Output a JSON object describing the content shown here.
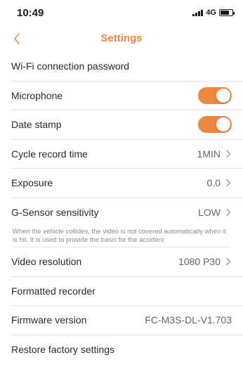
{
  "status_bar": {
    "time": "10:49",
    "network": "4G"
  },
  "nav": {
    "title": "Settings",
    "back_icon": "chevron-left-icon"
  },
  "colors": {
    "accent": "#ef8640",
    "divider": "#e3e3e3",
    "text": "#2b2b2b",
    "secondary": "#666666"
  },
  "settings": {
    "wifi_password": {
      "label": "Wi-Fi connection password"
    },
    "microphone": {
      "label": "Microphone",
      "enabled": true
    },
    "date_stamp": {
      "label": "Date stamp",
      "enabled": true
    },
    "cycle_record": {
      "label": "Cycle record time",
      "value": "1MIN"
    },
    "exposure": {
      "label": "Exposure",
      "value": "0.0"
    },
    "gsensor": {
      "label": "G-Sensor sensitivity",
      "value": "LOW",
      "note": "When the vehicle collides, the video is not covered automatically when it is hit. It is used to provide the basis for the accident"
    },
    "video_resolution": {
      "label": "Video resolution",
      "value": "1080 P30"
    },
    "formatted_recorder": {
      "label": "Formatted recorder"
    },
    "firmware_version": {
      "label": "Firmware version",
      "value": "FC-M3S-DL-V1.703"
    },
    "restore_factory": {
      "label": "Restore factory settings"
    }
  }
}
